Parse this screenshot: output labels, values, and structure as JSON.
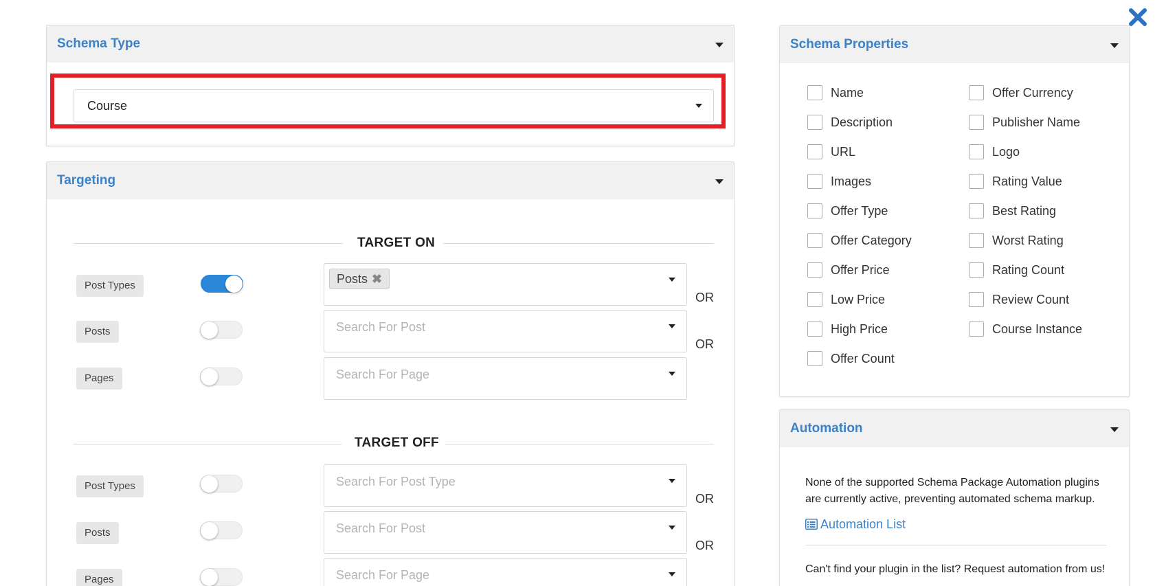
{
  "schema_type": {
    "title": "Schema Type",
    "selected": "Course"
  },
  "targeting": {
    "title": "Targeting",
    "target_on": {
      "heading": "TARGET ON",
      "rows": [
        {
          "label": "Post Types",
          "enabled": true,
          "chip": "Posts",
          "placeholder": "",
          "or": "OR"
        },
        {
          "label": "Posts",
          "enabled": false,
          "placeholder": "Search For Post",
          "or": "OR"
        },
        {
          "label": "Pages",
          "enabled": false,
          "placeholder": "Search For Page",
          "or": ""
        }
      ]
    },
    "target_off": {
      "heading": "TARGET OFF",
      "rows": [
        {
          "label": "Post Types",
          "enabled": false,
          "placeholder": "Search For Post Type",
          "or": "OR"
        },
        {
          "label": "Posts",
          "enabled": false,
          "placeholder": "Search For Post",
          "or": "OR"
        },
        {
          "label": "Pages",
          "enabled": false,
          "placeholder": "Search For Page",
          "or": ""
        }
      ]
    }
  },
  "schema_properties": {
    "title": "Schema Properties",
    "left": [
      "Name",
      "Description",
      "URL",
      "Images",
      "Offer Type",
      "Offer Category",
      "Offer Price",
      "Low Price",
      "High Price",
      "Offer Count"
    ],
    "right": [
      "Offer Currency",
      "Publisher Name",
      "Logo",
      "Rating Value",
      "Best Rating",
      "Worst Rating",
      "Rating Count",
      "Review Count",
      "Course Instance"
    ]
  },
  "automation": {
    "title": "Automation",
    "message": "None of the supported Schema Package Automation plugins are currently active, preventing automated schema markup.",
    "link_label": "Automation List",
    "request_text": "Can't find your plugin in the list? Request automation from us!"
  },
  "colors": {
    "accent": "#3b82c9",
    "toggle_on": "#2b88d8",
    "highlight": "#e61e25"
  }
}
